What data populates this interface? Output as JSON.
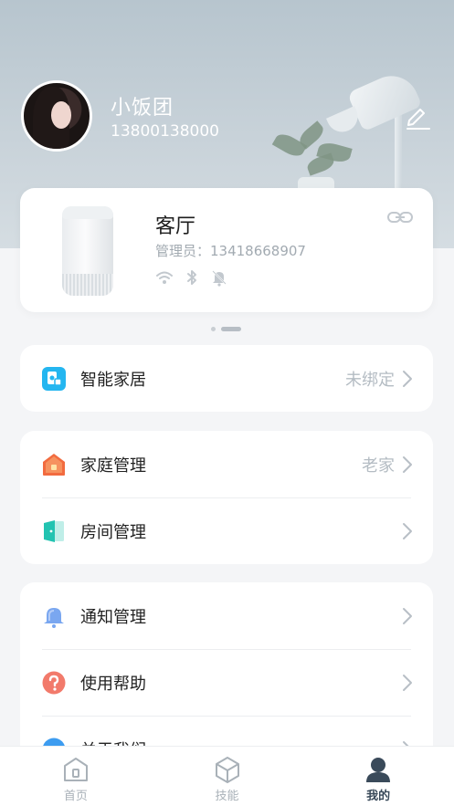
{
  "profile": {
    "name": "小饭团",
    "phone": "13800138000"
  },
  "device": {
    "room": "客厅",
    "admin": "管理员：13418668907",
    "status_icons": [
      "wifi-icon",
      "bluetooth-icon",
      "bell-off-icon"
    ]
  },
  "groups": {
    "smart": {
      "label": "智能家居",
      "value": "未绑定",
      "icon": "smart-home-icon"
    },
    "family": {
      "label": "家庭管理",
      "value": "老家",
      "icon": "house-icon"
    },
    "room": {
      "label": "房间管理",
      "icon": "door-icon"
    },
    "notice": {
      "label": "通知管理",
      "icon": "bell-icon"
    },
    "help": {
      "label": "使用帮助",
      "icon": "help-icon"
    },
    "about": {
      "label": "关于我们",
      "icon": "info-icon"
    }
  },
  "tabs": [
    {
      "label": "首页",
      "icon": "home-icon"
    },
    {
      "label": "技能",
      "icon": "cube-icon"
    },
    {
      "label": "我的",
      "icon": "person-icon"
    }
  ],
  "colors": {
    "accent_blue": "#24b6f0",
    "house_orange": "#f26b3f",
    "door_teal": "#22c3b1",
    "bell_blue": "#7aa7f0",
    "help_red": "#f27a6b",
    "about_blue": "#3d9cf0"
  }
}
